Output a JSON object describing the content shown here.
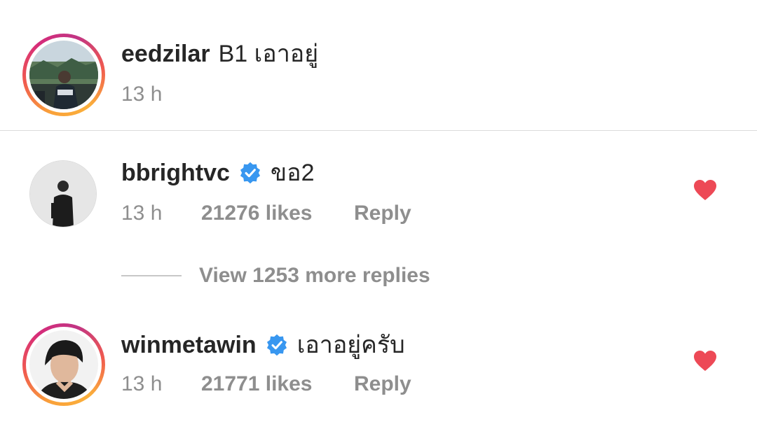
{
  "comments": [
    {
      "username": "eedzilar",
      "text": "B1 เอาอยู่",
      "time": "13 h",
      "verified": false,
      "story_ring": true
    },
    {
      "username": "bbrightvc",
      "text": "ขอ2",
      "time": "13 h",
      "likes": "21276 likes",
      "reply_label": "Reply",
      "verified": true,
      "liked": true
    },
    {
      "username": "winmetawin",
      "text": "เอาอยู่ครับ",
      "time": "13 h",
      "likes": "21771 likes",
      "reply_label": "Reply",
      "verified": true,
      "liked": true,
      "story_ring": true
    }
  ],
  "view_more_replies": "View 1253 more replies",
  "colors": {
    "heart": "#ed4956",
    "verified": "#3897f0",
    "secondary_text": "#8e8e8e"
  }
}
